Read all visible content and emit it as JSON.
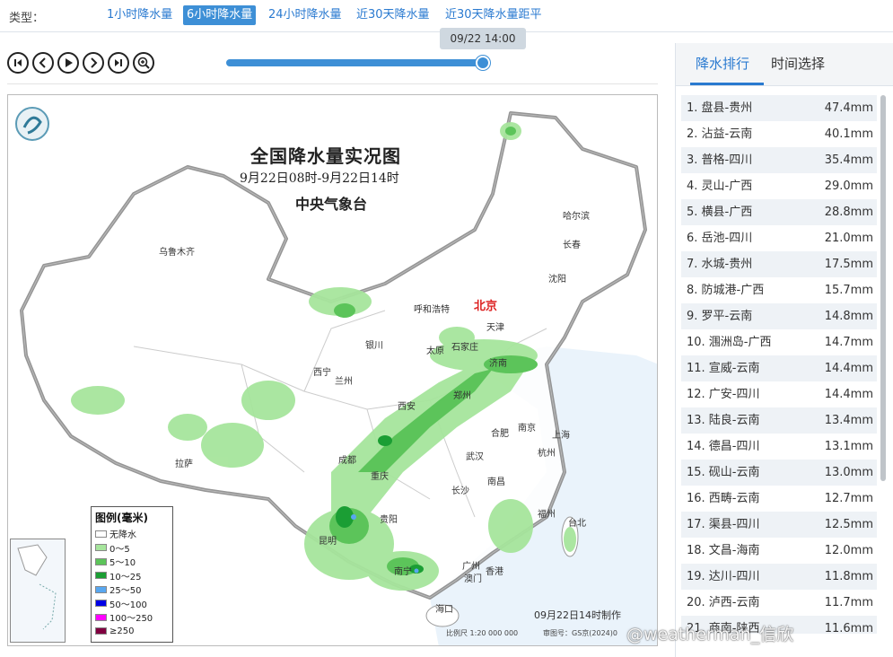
{
  "type_bar": {
    "label": "类型：",
    "tabs": [
      {
        "label": "1小时降水量"
      },
      {
        "label": "6小时降水量"
      },
      {
        "label": "24小时降水量"
      },
      {
        "label": "近30天降水量"
      },
      {
        "label": "近30天降水量距平"
      }
    ],
    "active_tab": "6小时降水量"
  },
  "player": {
    "tooltip": "09/22 14:00",
    "progress": 1.0,
    "buttons": [
      "first-frame-icon",
      "prev-frame-icon",
      "play-icon",
      "next-frame-icon",
      "last-frame-icon",
      "zoom-in-icon"
    ]
  },
  "map": {
    "title": "全国降水量实况图",
    "subtitle": "9月22日08时-9月22日14时",
    "agency": "中央气象台",
    "cities": [
      {
        "name": "乌鲁木齐"
      },
      {
        "name": "哈尔滨"
      },
      {
        "name": "长春"
      },
      {
        "name": "沈阳"
      },
      {
        "name": "呼和浩特"
      },
      {
        "name": "北京"
      },
      {
        "name": "天津"
      },
      {
        "name": "银川"
      },
      {
        "name": "太原"
      },
      {
        "name": "石家庄"
      },
      {
        "name": "济南"
      },
      {
        "name": "西宁"
      },
      {
        "name": "兰州"
      },
      {
        "name": "郑州"
      },
      {
        "name": "西安"
      },
      {
        "name": "合肥"
      },
      {
        "name": "南京"
      },
      {
        "name": "上海"
      },
      {
        "name": "拉萨"
      },
      {
        "name": "成都"
      },
      {
        "name": "武汉"
      },
      {
        "name": "杭州"
      },
      {
        "name": "重庆"
      },
      {
        "name": "长沙"
      },
      {
        "name": "南昌"
      },
      {
        "name": "贵阳"
      },
      {
        "name": "福州"
      },
      {
        "name": "台北"
      },
      {
        "name": "昆明"
      },
      {
        "name": "南宁"
      },
      {
        "name": "广州"
      },
      {
        "name": "香港"
      },
      {
        "name": "澳门"
      },
      {
        "name": "海口"
      }
    ],
    "legend": {
      "title": "图例(毫米)",
      "items": [
        {
          "label": "无降水",
          "color": "#ffffff"
        },
        {
          "label": "0～5",
          "color": "#a6e59c"
        },
        {
          "label": "5～10",
          "color": "#5cc45a"
        },
        {
          "label": "10～25",
          "color": "#1b9e34"
        },
        {
          "label": "25～50",
          "color": "#58a7f0"
        },
        {
          "label": "50～100",
          "color": "#0000e6"
        },
        {
          "label": "100～250",
          "color": "#ff00ff"
        },
        {
          "label": "≥250",
          "color": "#800040"
        }
      ]
    },
    "made_time": "09月22日14时制作",
    "scale": "比例尺 1:20 000 000",
    "review": "审图号：GS京(2024)0"
  },
  "watermark": "@weatherman_信欣",
  "sidebar": {
    "tabs": [
      {
        "label": "降水排行"
      },
      {
        "label": "时间选择"
      }
    ],
    "ranking": [
      {
        "name": "1. 盘县-贵州",
        "value": "47.4mm"
      },
      {
        "name": "2. 沾益-云南",
        "value": "40.1mm"
      },
      {
        "name": "3. 普格-四川",
        "value": "35.4mm"
      },
      {
        "name": "4. 灵山-广西",
        "value": "29.0mm"
      },
      {
        "name": "5. 横县-广西",
        "value": "28.8mm"
      },
      {
        "name": "6. 岳池-四川",
        "value": "21.0mm"
      },
      {
        "name": "7. 水城-贵州",
        "value": "17.5mm"
      },
      {
        "name": "8. 防城港-广西",
        "value": "15.7mm"
      },
      {
        "name": "9. 罗平-云南",
        "value": "14.8mm"
      },
      {
        "name": "10. 涠洲岛-广西",
        "value": "14.7mm"
      },
      {
        "name": "11. 宣威-云南",
        "value": "14.4mm"
      },
      {
        "name": "12. 广安-四川",
        "value": "14.4mm"
      },
      {
        "name": "13. 陆良-云南",
        "value": "13.4mm"
      },
      {
        "name": "14. 德昌-四川",
        "value": "13.1mm"
      },
      {
        "name": "15. 砚山-云南",
        "value": "13.0mm"
      },
      {
        "name": "16. 西畴-云南",
        "value": "12.7mm"
      },
      {
        "name": "17. 渠县-四川",
        "value": "12.5mm"
      },
      {
        "name": "18. 文昌-海南",
        "value": "12.0mm"
      },
      {
        "name": "19. 达川-四川",
        "value": "11.8mm"
      },
      {
        "name": "20. 泸西-云南",
        "value": "11.7mm"
      },
      {
        "name": "21. 商南-陕西",
        "value": "11.6mm"
      }
    ]
  }
}
